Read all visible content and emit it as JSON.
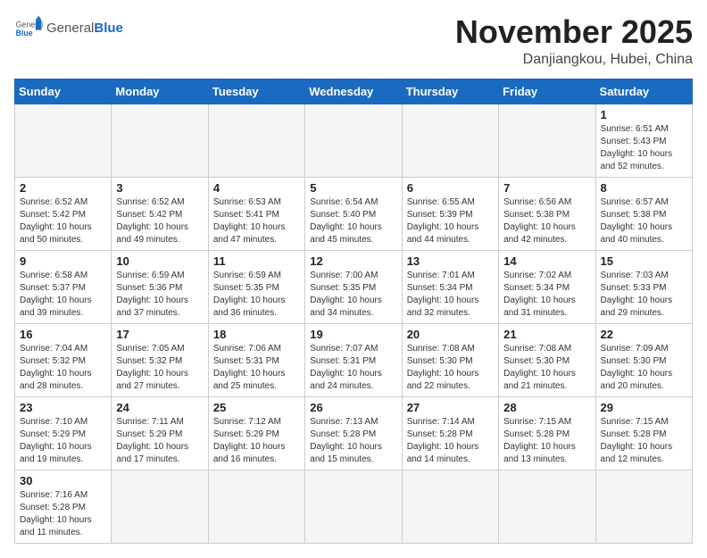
{
  "header": {
    "logo_general": "General",
    "logo_blue": "Blue",
    "title": "November 2025",
    "subtitle": "Danjiangkou, Hubei, China"
  },
  "weekdays": [
    "Sunday",
    "Monday",
    "Tuesday",
    "Wednesday",
    "Thursday",
    "Friday",
    "Saturday"
  ],
  "weeks": [
    [
      {
        "day": "",
        "info": ""
      },
      {
        "day": "",
        "info": ""
      },
      {
        "day": "",
        "info": ""
      },
      {
        "day": "",
        "info": ""
      },
      {
        "day": "",
        "info": ""
      },
      {
        "day": "",
        "info": ""
      },
      {
        "day": "1",
        "info": "Sunrise: 6:51 AM\nSunset: 5:43 PM\nDaylight: 10 hours\nand 52 minutes."
      }
    ],
    [
      {
        "day": "2",
        "info": "Sunrise: 6:52 AM\nSunset: 5:42 PM\nDaylight: 10 hours\nand 50 minutes."
      },
      {
        "day": "3",
        "info": "Sunrise: 6:52 AM\nSunset: 5:42 PM\nDaylight: 10 hours\nand 49 minutes."
      },
      {
        "day": "4",
        "info": "Sunrise: 6:53 AM\nSunset: 5:41 PM\nDaylight: 10 hours\nand 47 minutes."
      },
      {
        "day": "5",
        "info": "Sunrise: 6:54 AM\nSunset: 5:40 PM\nDaylight: 10 hours\nand 45 minutes."
      },
      {
        "day": "6",
        "info": "Sunrise: 6:55 AM\nSunset: 5:39 PM\nDaylight: 10 hours\nand 44 minutes."
      },
      {
        "day": "7",
        "info": "Sunrise: 6:56 AM\nSunset: 5:38 PM\nDaylight: 10 hours\nand 42 minutes."
      },
      {
        "day": "8",
        "info": "Sunrise: 6:57 AM\nSunset: 5:38 PM\nDaylight: 10 hours\nand 40 minutes."
      }
    ],
    [
      {
        "day": "9",
        "info": "Sunrise: 6:58 AM\nSunset: 5:37 PM\nDaylight: 10 hours\nand 39 minutes."
      },
      {
        "day": "10",
        "info": "Sunrise: 6:59 AM\nSunset: 5:36 PM\nDaylight: 10 hours\nand 37 minutes."
      },
      {
        "day": "11",
        "info": "Sunrise: 6:59 AM\nSunset: 5:35 PM\nDaylight: 10 hours\nand 36 minutes."
      },
      {
        "day": "12",
        "info": "Sunrise: 7:00 AM\nSunset: 5:35 PM\nDaylight: 10 hours\nand 34 minutes."
      },
      {
        "day": "13",
        "info": "Sunrise: 7:01 AM\nSunset: 5:34 PM\nDaylight: 10 hours\nand 32 minutes."
      },
      {
        "day": "14",
        "info": "Sunrise: 7:02 AM\nSunset: 5:34 PM\nDaylight: 10 hours\nand 31 minutes."
      },
      {
        "day": "15",
        "info": "Sunrise: 7:03 AM\nSunset: 5:33 PM\nDaylight: 10 hours\nand 29 minutes."
      }
    ],
    [
      {
        "day": "16",
        "info": "Sunrise: 7:04 AM\nSunset: 5:32 PM\nDaylight: 10 hours\nand 28 minutes."
      },
      {
        "day": "17",
        "info": "Sunrise: 7:05 AM\nSunset: 5:32 PM\nDaylight: 10 hours\nand 27 minutes."
      },
      {
        "day": "18",
        "info": "Sunrise: 7:06 AM\nSunset: 5:31 PM\nDaylight: 10 hours\nand 25 minutes."
      },
      {
        "day": "19",
        "info": "Sunrise: 7:07 AM\nSunset: 5:31 PM\nDaylight: 10 hours\nand 24 minutes."
      },
      {
        "day": "20",
        "info": "Sunrise: 7:08 AM\nSunset: 5:30 PM\nDaylight: 10 hours\nand 22 minutes."
      },
      {
        "day": "21",
        "info": "Sunrise: 7:08 AM\nSunset: 5:30 PM\nDaylight: 10 hours\nand 21 minutes."
      },
      {
        "day": "22",
        "info": "Sunrise: 7:09 AM\nSunset: 5:30 PM\nDaylight: 10 hours\nand 20 minutes."
      }
    ],
    [
      {
        "day": "23",
        "info": "Sunrise: 7:10 AM\nSunset: 5:29 PM\nDaylight: 10 hours\nand 19 minutes."
      },
      {
        "day": "24",
        "info": "Sunrise: 7:11 AM\nSunset: 5:29 PM\nDaylight: 10 hours\nand 17 minutes."
      },
      {
        "day": "25",
        "info": "Sunrise: 7:12 AM\nSunset: 5:29 PM\nDaylight: 10 hours\nand 16 minutes."
      },
      {
        "day": "26",
        "info": "Sunrise: 7:13 AM\nSunset: 5:28 PM\nDaylight: 10 hours\nand 15 minutes."
      },
      {
        "day": "27",
        "info": "Sunrise: 7:14 AM\nSunset: 5:28 PM\nDaylight: 10 hours\nand 14 minutes."
      },
      {
        "day": "28",
        "info": "Sunrise: 7:15 AM\nSunset: 5:28 PM\nDaylight: 10 hours\nand 13 minutes."
      },
      {
        "day": "29",
        "info": "Sunrise: 7:15 AM\nSunset: 5:28 PM\nDaylight: 10 hours\nand 12 minutes."
      }
    ],
    [
      {
        "day": "30",
        "info": "Sunrise: 7:16 AM\nSunset: 5:28 PM\nDaylight: 10 hours\nand 11 minutes."
      },
      {
        "day": "",
        "info": ""
      },
      {
        "day": "",
        "info": ""
      },
      {
        "day": "",
        "info": ""
      },
      {
        "day": "",
        "info": ""
      },
      {
        "day": "",
        "info": ""
      },
      {
        "day": "",
        "info": ""
      }
    ]
  ]
}
